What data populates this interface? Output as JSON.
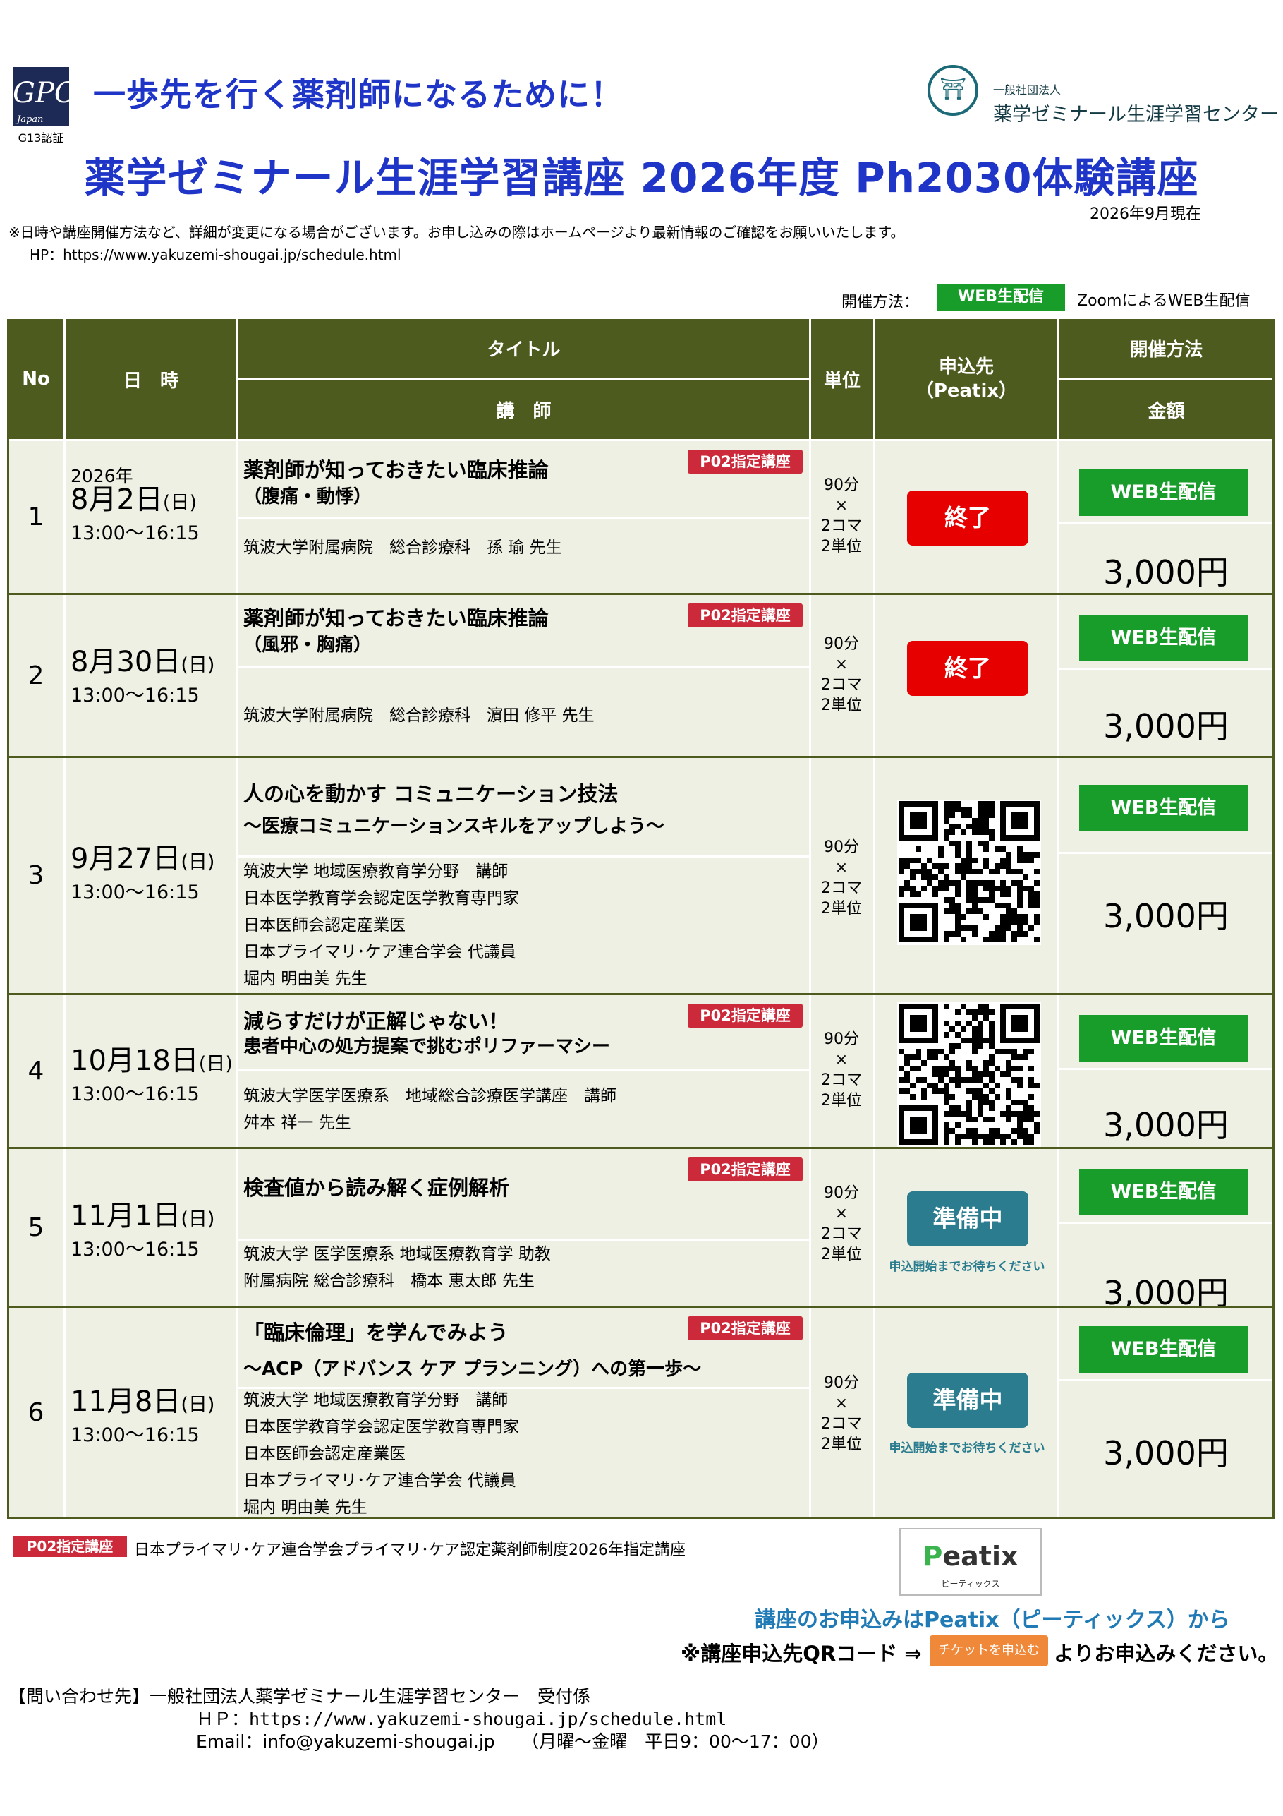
{
  "header": {
    "gpc_logo": "GPC",
    "gpc_logo_sub": "Japan",
    "g13": "G13認証",
    "catchphrase": "一歩先を行く薬剤師になるために！",
    "center_small": "一般社団法人",
    "center_name": "薬学ゼミナール生涯学習センター",
    "main_title": "薬学ゼミナール生涯学習講座 2026年度 Ph2030体験講座",
    "as_of": "2026年9月現在",
    "notice": "※日時や講座開催方法など、詳細が変更になる場合がございます。お申し込みの際はホームページより最新情報のご確認をお願いいたします。",
    "hp": "HP：https://www.yakuzemi-shougai.jp/schedule.html",
    "legend_label": "開催方法：",
    "legend_badge": "WEB生配信",
    "legend_text": "ZoomによるWEB生配信"
  },
  "table_head": {
    "no": "No",
    "datetime": "日　時",
    "title": "タイトル",
    "lecturer": "講　師",
    "unit": "単位",
    "apply": "申込先\n（Peatix）",
    "method": "開催方法",
    "price": "金額"
  },
  "rows": [
    {
      "no": "1",
      "year": "2026年",
      "date_md": "8月2日",
      "date_dow": "(日)",
      "time": "13:00～16:15",
      "title1": "薬剤師が知っておきたい臨床推論",
      "title2": "（腹痛・動悸）",
      "p02": "P02指定講座",
      "lecturer": [
        "筑波大学附属病院　総合診療科　孫 瑜 先生"
      ],
      "unit": [
        "90分",
        "×",
        "2コマ",
        "2単位"
      ],
      "status": "終了",
      "method": "WEB生配信",
      "price": "3,000円"
    },
    {
      "no": "2",
      "date_md": "8月30日",
      "date_dow": "(日)",
      "time": "13:00～16:15",
      "title1": "薬剤師が知っておきたい臨床推論",
      "title2": "（風邪・胸痛）",
      "p02": "P02指定講座",
      "lecturer": [
        "筑波大学附属病院　総合診療科　濵田 修平 先生"
      ],
      "unit": [
        "90分",
        "×",
        "2コマ",
        "2単位"
      ],
      "status": "終了",
      "method": "WEB生配信",
      "price": "3,000円"
    },
    {
      "no": "3",
      "date_md": "9月27日",
      "date_dow": "(日)",
      "time": "13:00～16:15",
      "title1": "人の心を動かす コミュニケーション技法",
      "title2": "～医療コミュニケーションスキルをアップしよう～",
      "lecturer": [
        "筑波大学 地域医療教育学分野　講師",
        "日本医学教育学会認定医学教育専門家",
        "日本医師会認定産業医",
        "日本プライマリ･ケア連合学会 代議員",
        "堀内 明由美 先生"
      ],
      "unit": [
        "90分",
        "×",
        "2コマ",
        "2単位"
      ],
      "status": "QR",
      "method": "WEB生配信",
      "price": "3,000円"
    },
    {
      "no": "4",
      "date_md": "10月18日",
      "date_dow": "(日)",
      "time": "13:00～16:15",
      "title1": "減らすだけが正解じゃない！",
      "title2": "患者中心の処方提案で挑むポリファーマシー",
      "p02": "P02指定講座",
      "lecturer": [
        "筑波大学医学医療系　地域総合診療医学講座　講師",
        "舛本 祥一 先生"
      ],
      "unit": [
        "90分",
        "×",
        "2コマ",
        "2単位"
      ],
      "status": "QR",
      "method": "WEB生配信",
      "price": "3,000円"
    },
    {
      "no": "5",
      "date_md": "11月1日",
      "date_dow": "(日)",
      "time": "13:00～16:15",
      "title1": "検査値から読み解く症例解析",
      "p02": "P02指定講座",
      "lecturer": [
        "筑波大学 医学医療系 地域医療教育学 助教",
        "附属病院 総合診療科　橋本 恵太郎 先生"
      ],
      "unit": [
        "90分",
        "×",
        "2コマ",
        "2単位"
      ],
      "status": "準備中",
      "status_note": "申込開始までお待ちください",
      "method": "WEB生配信",
      "price": "3,000円"
    },
    {
      "no": "6",
      "date_md": "11月8日",
      "date_dow": "(日)",
      "time": "13:00～16:15",
      "title1": "「臨床倫理」を学んでみよう",
      "title2": "～ACP（アドバンス ケア プランニング）への第一歩～",
      "p02": "P02指定講座",
      "lecturer": [
        "筑波大学 地域医療教育学分野　講師",
        "日本医学教育学会認定医学教育専門家",
        "日本医師会認定産業医",
        "日本プライマリ･ケア連合学会 代議員",
        "堀内 明由美 先生"
      ],
      "unit": [
        "90分",
        "×",
        "2コマ",
        "2単位"
      ],
      "status": "準備中",
      "status_note": "申込開始までお待ちください",
      "method": "WEB生配信",
      "price": "3,000円"
    }
  ],
  "footer": {
    "p02_badge": "P02指定講座",
    "p02_text": "日本プライマリ･ケア連合学会プライマリ･ケア認定薬剤師制度2026年指定講座",
    "peatix_logo_p": "P",
    "peatix_logo_rest": "eatix",
    "peatix_sub": "ピーティックス",
    "apply_line": "講座のお申込みはPeatix（ピーティックス）から",
    "qr_line_a": "※講座申込先QRコード ⇒",
    "ticket_button": "チケットを申込む",
    "qr_line_b": "よりお申込みください。",
    "contact": "【問い合わせ先】一般社団法人薬学ゼミナール生涯学習センター　受付係",
    "contact_hp": "ＨＰ：https://www.yakuzemi-shougai.jp/schedule.html",
    "contact_email": "Email：info@yakuzemi-shougai.jp　　（月曜～金曜　平日9：00～17：00）"
  },
  "colors": {
    "header_bg": "#4d5b1e",
    "row_bg": "#eef0e4",
    "web": "#189c2a",
    "end": "#e60000",
    "prep": "#2a7c8e",
    "p02": "#cc2a3a",
    "title_blue": "#1f35c8"
  }
}
